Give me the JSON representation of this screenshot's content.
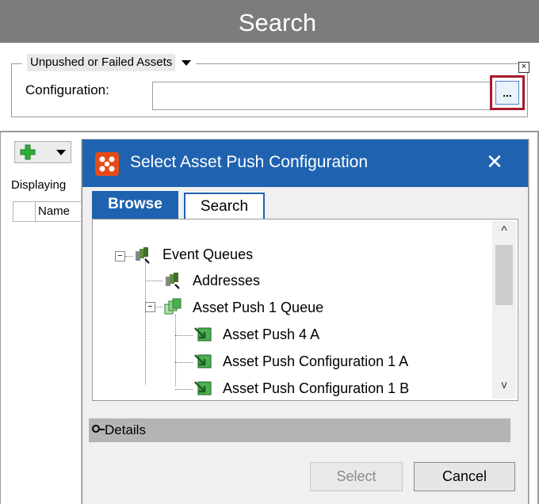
{
  "header": {
    "title": "Search"
  },
  "filter": {
    "dropdown_label": "Unpushed or Failed Assets",
    "close_glyph": "×",
    "configuration_label": "Configuration:",
    "configuration_value": "",
    "browse_button_label": "..."
  },
  "panel": {
    "displaying_label": "Displaying",
    "details_label_fragment": "ils",
    "grid_name_header": "Name",
    "scroll_right_glyph": ">"
  },
  "dialog": {
    "title": "Select Asset Push Configuration",
    "close_glyph": "✕",
    "tabs": [
      {
        "label": "Browse",
        "active": true
      },
      {
        "label": "Search",
        "active": false
      }
    ],
    "tree": [
      {
        "label": "Event Queues",
        "level": 0,
        "expander": "−",
        "icon": "event-queues-icon"
      },
      {
        "label": "Addresses",
        "level": 1,
        "expander": "",
        "icon": "addresses-icon"
      },
      {
        "label": "Asset Push 1 Queue",
        "level": 1,
        "expander": "−",
        "icon": "asset-push-queue-icon"
      },
      {
        "label": "Asset Push 4 A",
        "level": 2,
        "expander": "",
        "icon": "asset-push-config-icon"
      },
      {
        "label": "Asset Push Configuration 1 A",
        "level": 2,
        "expander": "",
        "icon": "asset-push-config-icon"
      },
      {
        "label": "Asset Push Configuration 1 B",
        "level": 2,
        "expander": "",
        "icon": "asset-push-config-icon"
      }
    ],
    "scroll_up_glyph": "^",
    "scroll_down_glyph": "v",
    "details_label": "Details",
    "select_label": "Select",
    "cancel_label": "Cancel"
  },
  "colors": {
    "header_bg": "#7c7c7c",
    "dialog_title_bg": "#1f63b0",
    "highlight_border": "#a8192a",
    "details_bar_bg": "#b4b4b4"
  }
}
